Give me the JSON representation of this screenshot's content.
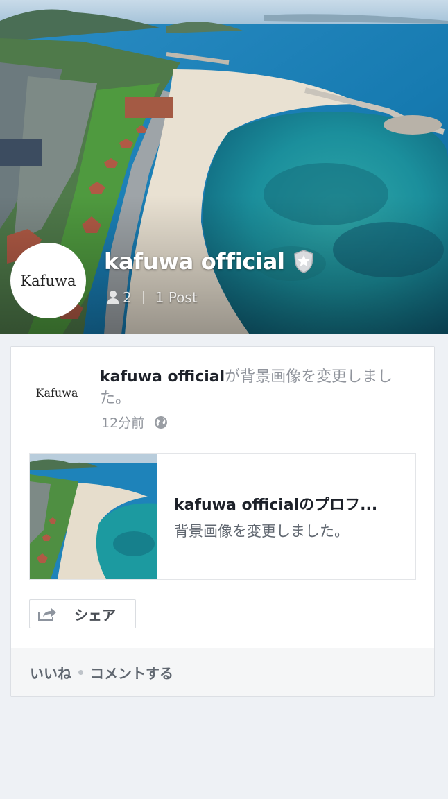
{
  "profile": {
    "name": "kafuwa official",
    "avatar_text": "Kafuwa",
    "members": "2",
    "posts": "1 Post",
    "badge_icon": "verified-shield-star-icon"
  },
  "post": {
    "avatar_text": "Kafuwa",
    "actor": "kafuwa official",
    "action": "が背景画像を変更しました。",
    "time": "12分前",
    "privacy_icon": "globe-icon",
    "attachment": {
      "title": "kafuwa officialのプロフ...",
      "description": "背景画像を変更しました。"
    },
    "share_label": "シェア"
  },
  "footer": {
    "like": "いいね",
    "comment": "コメントする"
  },
  "colors": {
    "background": "#eef1f5",
    "card": "#ffffff",
    "text_dark": "#1d2129",
    "text_muted": "#90949c"
  }
}
